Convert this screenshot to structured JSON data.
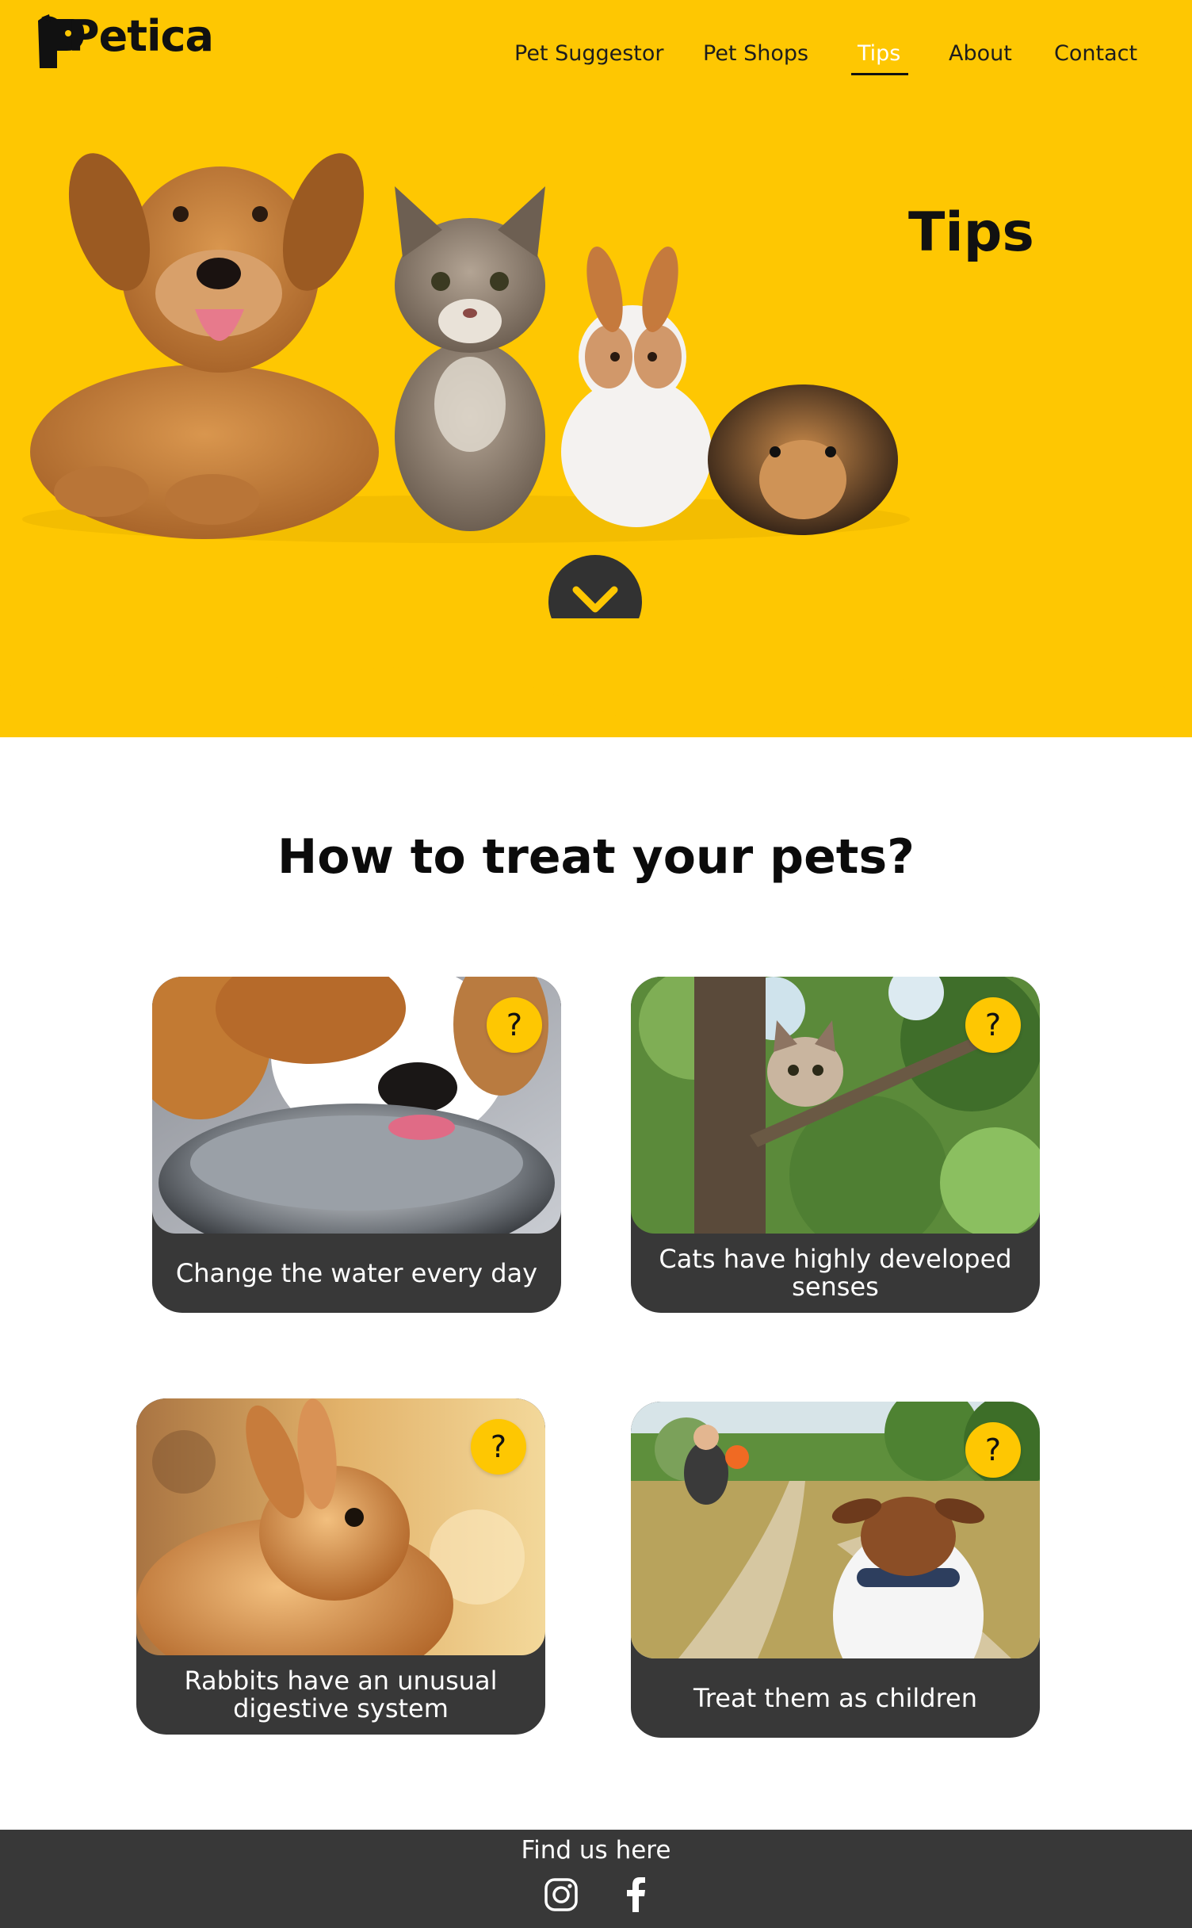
{
  "brand": {
    "logo_text": "Petica"
  },
  "nav": {
    "items": [
      {
        "label": "Pet Suggestor",
        "active": false
      },
      {
        "label": "Pet Shops",
        "active": false
      },
      {
        "label": "Tips",
        "active": true
      },
      {
        "label": "About",
        "active": false
      },
      {
        "label": "Contact",
        "active": false
      }
    ]
  },
  "hero": {
    "title": "Tips",
    "scroll_icon": "chevron-down-icon"
  },
  "main": {
    "title": "How to treat your pets?",
    "cards": [
      {
        "caption": "Change the water every day",
        "badge": "?",
        "image": "dog-drinking-water-photo"
      },
      {
        "caption": "Cats have highly developed senses",
        "badge": "?",
        "image": "kitten-in-tree-photo"
      },
      {
        "caption": "Rabbits have an unusual digestive system",
        "badge": "?",
        "image": "bunny-photo"
      },
      {
        "caption": "Treat them as children",
        "badge": "?",
        "image": "dog-on-path-photo"
      }
    ]
  },
  "footer": {
    "title": "Find us here",
    "social": [
      "instagram-icon",
      "facebook-icon"
    ]
  },
  "colors": {
    "accent": "#FEC702",
    "dark": "#383838",
    "text": "#111111"
  }
}
